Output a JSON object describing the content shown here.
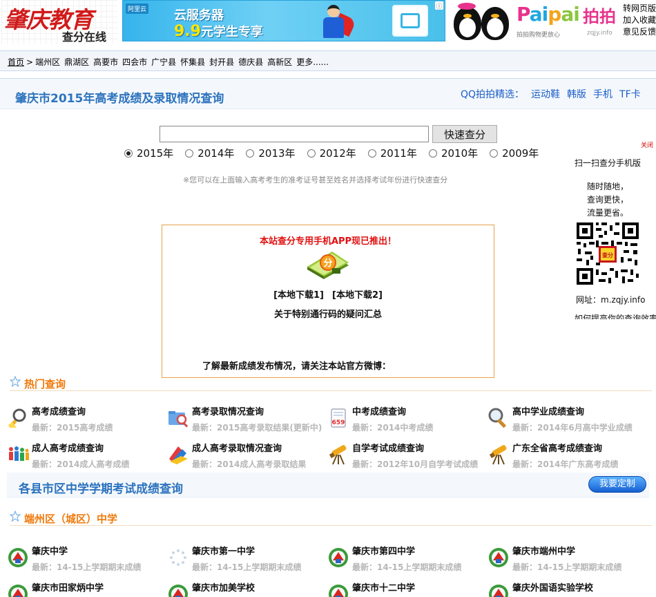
{
  "header": {
    "logo_title": "肇庆教育",
    "logo_subtitle": "查分在线",
    "ad": {
      "brand": "阿里云",
      "line1": "云服务器",
      "price": "9.9",
      "line2_rest": "元学生专享",
      "info_icon": "info-icon"
    },
    "paipai": {
      "word_p1": "P",
      "word_p2": "ai",
      "word_p3": "p",
      "word_p4": "ai",
      "cn": "拍拍",
      "slogan": "拍拍购物更放心",
      "site": "zqjy.info"
    },
    "links": [
      "转网页版",
      "加入收藏",
      "意见反馈"
    ]
  },
  "breadcrumb": {
    "home": "首页",
    "separator": ">",
    "items": [
      "端州区",
      "鼎湖区",
      "高要市",
      "四会市",
      "广宁县",
      "怀集县",
      "封开县",
      "德庆县",
      "高新区",
      "更多......"
    ]
  },
  "main": {
    "title": "肇庆市2015年高考成绩及录取情况查询",
    "qq_picks": {
      "label": "QQ拍拍精选：",
      "items": [
        "运动鞋",
        "韩版",
        "手机",
        "TF卡"
      ]
    },
    "search": {
      "value": "",
      "button": "快速查分",
      "tip": "※您可以在上面输入高考考生的准考证号甚至姓名并选择考试年份进行快速查分",
      "years": [
        "2015年",
        "2014年",
        "2013年",
        "2012年",
        "2011年",
        "2010年",
        "2009年"
      ],
      "selected_year": "2015年"
    },
    "app_box": {
      "title": "本站查分专用手机APP现已推出！",
      "icon_char": "分",
      "download1": "[本地下载1]",
      "download2": "[本地下载2]",
      "faq": "关于特别通行码的疑问汇总",
      "weibo": "了解最新成绩发布情况，请关注本站官方微博："
    }
  },
  "sidebar": {
    "close": "关闭",
    "title": "扫一扫查分手机版",
    "desc": [
      "随时随地，",
      "查询更快，",
      "流量更省。"
    ],
    "qr_badge": "查分",
    "url": "网址：m.zqjy.info",
    "more": "如何提高你的查询效率"
  },
  "hot": {
    "heading": "热门查询",
    "items": [
      {
        "name": "高考成绩查询",
        "latest": "最新：2015高考成绩",
        "icon": "magnifier-icon"
      },
      {
        "name": "高考录取情况查询",
        "latest": "最新：2015高考录取结果(更新中)",
        "icon": "folder-search-icon"
      },
      {
        "name": "中考成绩查询",
        "latest": "最新：2014中考成绩",
        "icon": "score-sheet-icon"
      },
      {
        "name": "高中学业成绩查询",
        "latest": "最新：2014年6月高中学业成绩",
        "icon": "search-tool-icon"
      },
      {
        "name": "成人高考成绩查询",
        "latest": "最新：2014成人高考成绩",
        "icon": "people-icon"
      },
      {
        "name": "成人高考录取情况查询",
        "latest": "最新：2014成人高考录取结果",
        "icon": "books-icon"
      },
      {
        "name": "自学考试成绩查询",
        "latest": "最新：2012年10月自学考试成绩",
        "icon": "telescope-icon"
      },
      {
        "name": "广东全省高考成绩查询",
        "latest": "最新：2014年广东高考成绩",
        "icon": "telescope-icon"
      }
    ]
  },
  "county": {
    "title": "各县市区中学学期考试成绩查询",
    "button": "我要定制"
  },
  "duanzhou": {
    "heading": "端州区（城区）中学",
    "items": [
      {
        "name": "肇庆中学",
        "latest": "最新：14-15上学期期末成绩",
        "icon": "school-emblem-icon"
      },
      {
        "name": "肇庆市第一中学",
        "latest": "最新：14-15上学期期末成绩",
        "icon": "loading-placeholder-icon"
      },
      {
        "name": "肇庆市第四中学",
        "latest": "最新：14-15上学期期末成绩",
        "icon": "school-emblem-icon"
      },
      {
        "name": "肇庆市端州中学",
        "latest": "最新：14-15上学期期末成绩",
        "icon": "school-emblem-icon"
      },
      {
        "name": "肇庆市田家炳中学",
        "latest": "",
        "icon": "school-emblem-icon"
      },
      {
        "name": "肇庆市加美学校",
        "latest": "",
        "icon": "school-emblem-icon"
      },
      {
        "name": "肇庆市十二中学",
        "latest": "",
        "icon": "school-emblem-icon"
      },
      {
        "name": "肇庆外国语实验学校",
        "latest": "",
        "icon": "school-emblem-icon"
      }
    ]
  },
  "colors": {
    "title_blue": "#2d73be",
    "section_orange": "#f07a0c",
    "alert_red": "#e01010",
    "box_border": "#e8a04a"
  }
}
